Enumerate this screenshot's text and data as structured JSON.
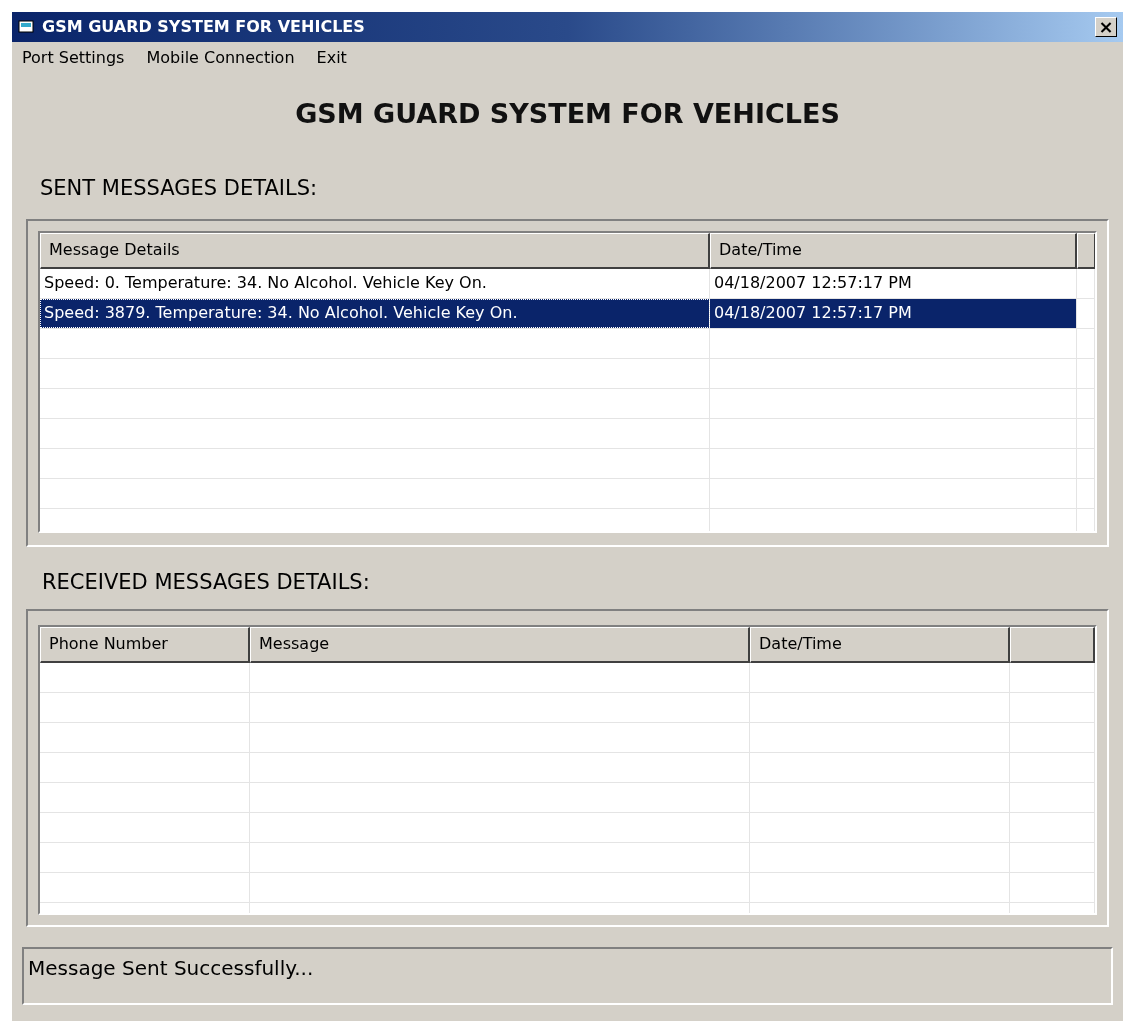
{
  "window": {
    "title": "GSM GUARD SYSTEM FOR VEHICLES",
    "close": "×"
  },
  "menu": [
    "Port Settings",
    "Mobile Connection",
    "Exit"
  ],
  "heading": "GSM GUARD SYSTEM FOR VEHICLES",
  "sent": {
    "label": "SENT MESSAGES DETAILS:",
    "columns": [
      "Message Details",
      "Date/Time"
    ],
    "rows": [
      {
        "cells": [
          "Speed: 0. Temperature: 34. No Alcohol. Vehicle Key On.",
          "04/18/2007 12:57:17 PM"
        ],
        "selected": false
      },
      {
        "cells": [
          "Speed: 3879. Temperature: 34. No Alcohol. Vehicle Key On.",
          "04/18/2007 12:57:17 PM"
        ],
        "selected": true
      }
    ]
  },
  "received": {
    "label": "RECEIVED MESSAGES DETAILS:",
    "columns": [
      "Phone Number",
      "Message",
      "Date/Time"
    ]
  },
  "status_bar": "Message Sent Successfully..."
}
